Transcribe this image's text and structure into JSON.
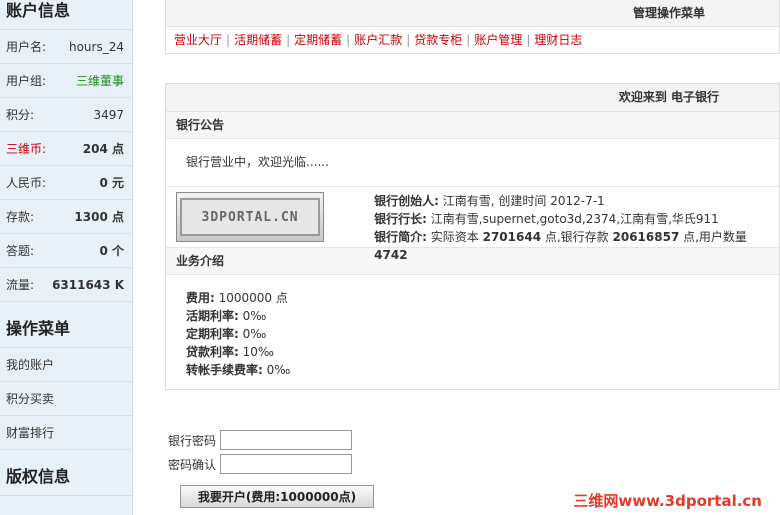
{
  "sidebar": {
    "account_title": "账户信息",
    "rows": [
      {
        "key": "用户名:",
        "value": "hours_24"
      },
      {
        "key": "用户组:",
        "value": "三维董事"
      },
      {
        "key": "积分:",
        "value": "3497"
      },
      {
        "key": "三维币:",
        "value": "204 点"
      },
      {
        "key": "人民币:",
        "value": "0 元"
      },
      {
        "key": "存款:",
        "value": "1300 点"
      },
      {
        "key": "答题:",
        "value": "0 个"
      },
      {
        "key": "流量:",
        "value": "6311643 K"
      }
    ],
    "menu_title": "操作菜单",
    "menu": [
      "我的账户",
      "积分买卖",
      "财富排行"
    ],
    "copyright_title": "版权信息"
  },
  "top_panel": {
    "title": "管理操作菜单",
    "nav": [
      "营业大厅",
      "活期储蓄",
      "定期储蓄",
      "账户汇款",
      "贷款专柜",
      "账户管理",
      "理财日志"
    ],
    "separator": "|"
  },
  "main_panel": {
    "title": "欢迎来到 电子银行",
    "notice_title": "银行公告",
    "notice_text": "银行营业中，欢迎光临......",
    "logo_text": "3DPORTAL.CN",
    "founder_label": "银行创始人:",
    "founder_value": " 江南有雪, 创建时间 2012-7-1",
    "president_label": "银行行长:",
    "president_value": " 江南有雪,supernet,goto3d,2374,江南有雪,华氏911",
    "intro_label": "银行简介:",
    "intro_p1": " 实际资本 ",
    "intro_capital": "2701644",
    "intro_p2": " 点,银行存款 ",
    "intro_deposit": "20616857",
    "intro_p3": " 点,用户数量 ",
    "intro_users": "4742",
    "biz_title": "业务介绍",
    "biz": [
      {
        "label": "费用:",
        "value": " 1000000 点"
      },
      {
        "label": "活期利率:",
        "value": " 0‰"
      },
      {
        "label": "定期利率:",
        "value": " 0‰"
      },
      {
        "label": "贷款利率:",
        "value": " 10‰"
      },
      {
        "label": "转帐手续费率:",
        "value": " 0‰"
      }
    ]
  },
  "form": {
    "password_label": "银行密码",
    "password_value": "",
    "confirm_label": "密码确认",
    "confirm_value": "",
    "submit_label": "我要开户(费用:1000000点)"
  },
  "watermark": "三维网www.3dportal.cn",
  "colors": {
    "link_red": "#cc0000",
    "group_green": "#1a8a1a",
    "sidebar_bg": "#e8f0f8"
  }
}
